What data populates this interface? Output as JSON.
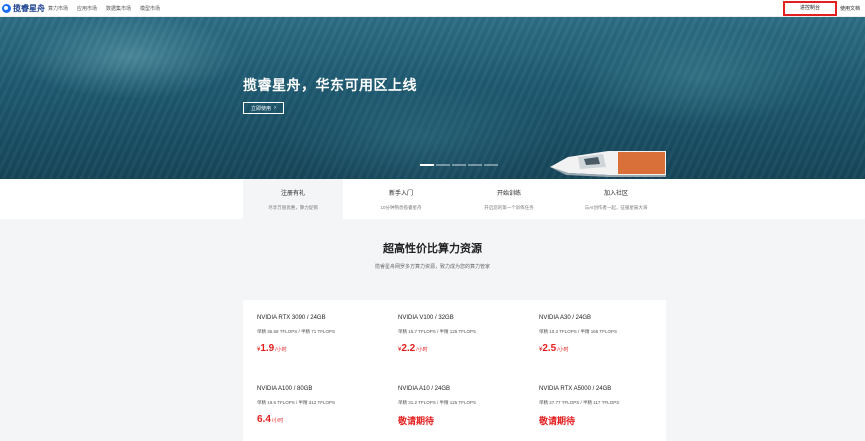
{
  "nav": {
    "logo_text": "揽睿星舟",
    "items": [
      "算力市场",
      "应用市场",
      "数据集市场",
      "模型市场"
    ],
    "console_label": "进控制台",
    "docs_label": "使用文档"
  },
  "hero": {
    "title": "揽睿星舟，华东可用区上线",
    "button_label": "立即使用",
    "slides": 5,
    "active_slide": 0
  },
  "features": [
    {
      "title": "注册有礼",
      "subtitle": "尽享万值优惠，算力促销"
    },
    {
      "title": "新手入门",
      "subtitle": "10分钟熟悉揽睿星舟"
    },
    {
      "title": "开始训练",
      "subtitle": "开启您的第一个训练任务"
    },
    {
      "title": "加入社区",
      "subtitle": "与AI创作者一起，征服星辰大海"
    }
  ],
  "section": {
    "title": "超高性价比算力资源",
    "subtitle": "揽睿星舟网罗多方算力资源，致力成为您的算力管家"
  },
  "gpus": [
    {
      "name": "NVIDIA RTX 3090 / 24GB",
      "spec": "单精 35.58 TFLOPS / 半精 71 TFLOPS",
      "currency": "¥",
      "price": "1.9",
      "unit": "/小时"
    },
    {
      "name": "NVIDIA V100 / 32GB",
      "spec": "单精 15.7 TFLOPS / 半精 125 TFLOPS",
      "currency": "¥",
      "price": "2.2",
      "unit": "/小时"
    },
    {
      "name": "NVIDIA A30 / 24GB",
      "spec": "单精 10.3 TFLOPS / 半精 165 TFLOPS",
      "currency": "¥",
      "price": "2.5",
      "unit": "/小时"
    },
    {
      "name": "NVIDIA A100 / 80GB",
      "spec": "单精 19.5 TFLOPS / 半精 312 TFLOPS",
      "currency": "",
      "price": "6.4",
      "unit": "/小时"
    },
    {
      "name": "NVIDIA A10 / 24GB",
      "spec": "单精 31.2 TFLOPS / 半精 125 TFLOPS",
      "coming": "敬请期待"
    },
    {
      "name": "NVIDIA RTX A5000 / 24GB",
      "spec": "单精 27.77 TFLOPS / 半精 117 TFLOPS",
      "coming": "敬请期待"
    }
  ],
  "colors": {
    "accent_red": "#e31f1f",
    "brand_blue": "#1a6ef5"
  }
}
